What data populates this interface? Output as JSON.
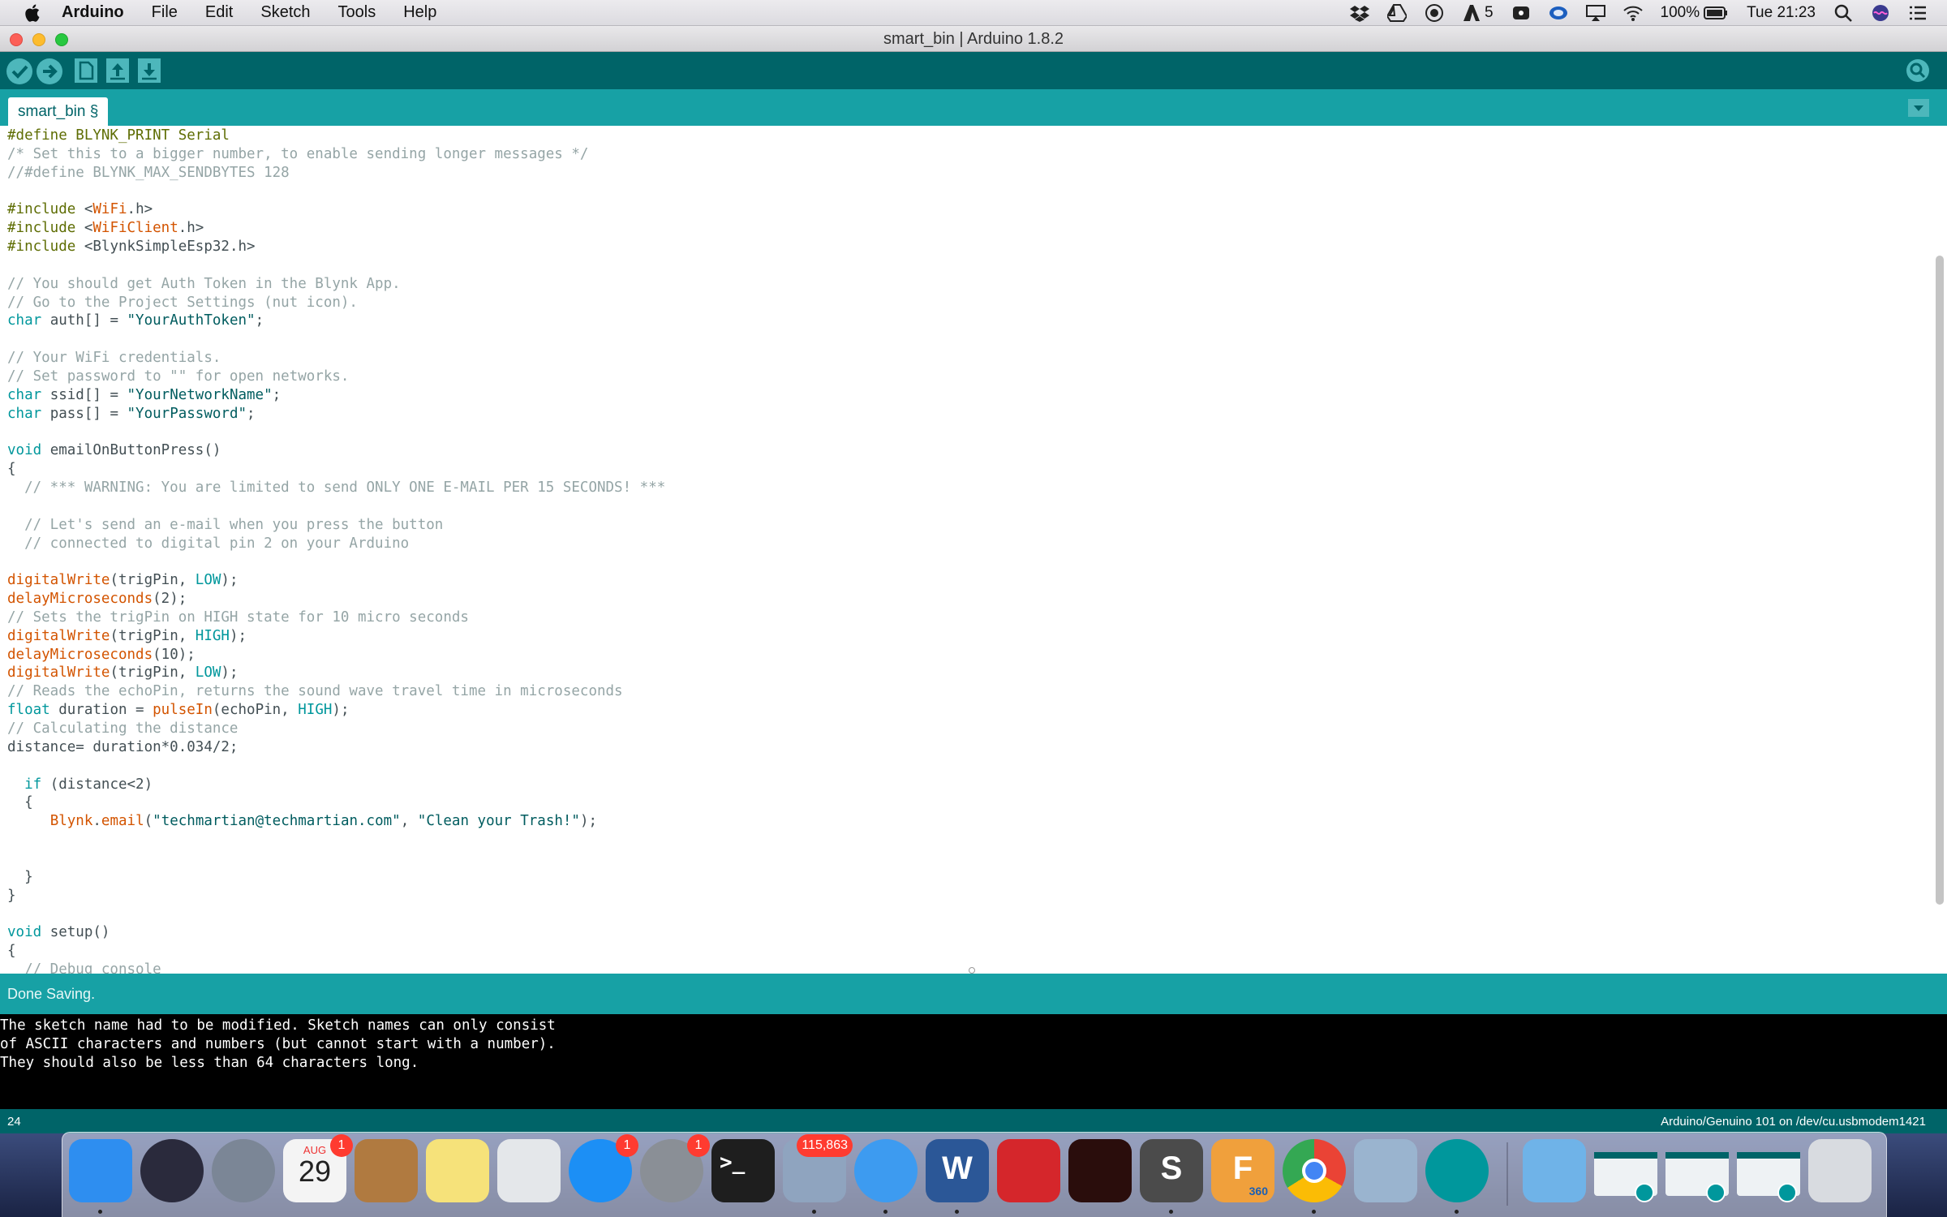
{
  "menubar": {
    "app_name": "Arduino",
    "menus": [
      "File",
      "Edit",
      "Sketch",
      "Tools",
      "Help"
    ],
    "status": {
      "adobe_count": "5",
      "battery": "100%",
      "clock": "Tue 21:23"
    }
  },
  "window": {
    "title": "smart_bin | Arduino 1.8.2"
  },
  "toolbar": {
    "buttons": [
      "verify-icon",
      "upload-icon",
      "new-icon",
      "open-icon",
      "save-icon"
    ],
    "serial_monitor_icon": "magnifier-icon"
  },
  "tabs": {
    "active": "smart_bin §"
  },
  "code_lines": [
    "#define BLYNK_PRINT Serial",
    "/* Set this to a bigger number, to enable sending longer messages */",
    "//#define BLYNK_MAX_SENDBYTES 128",
    "",
    "#include <WiFi.h>",
    "#include <WiFiClient.h>",
    "#include <BlynkSimpleEsp32.h>",
    "",
    "// You should get Auth Token in the Blynk App.",
    "// Go to the Project Settings (nut icon).",
    "char auth[] = \"YourAuthToken\";",
    "",
    "// Your WiFi credentials.",
    "// Set password to \"\" for open networks.",
    "char ssid[] = \"YourNetworkName\";",
    "char pass[] = \"YourPassword\";",
    "",
    "void emailOnButtonPress()",
    "{",
    "  // *** WARNING: You are limited to send ONLY ONE E-MAIL PER 15 SECONDS! ***",
    "",
    "  // Let's send an e-mail when you press the button",
    "  // connected to digital pin 2 on your Arduino",
    "",
    "digitalWrite(trigPin, LOW);",
    "delayMicroseconds(2);",
    "// Sets the trigPin on HIGH state for 10 micro seconds",
    "digitalWrite(trigPin, HIGH);",
    "delayMicroseconds(10);",
    "digitalWrite(trigPin, LOW);",
    "// Reads the echoPin, returns the sound wave travel time in microseconds",
    "float duration = pulseIn(echoPin, HIGH);",
    "// Calculating the distance",
    "distance= duration*0.034/2;",
    "",
    "  if (distance<2)",
    "  {",
    "     Blynk.email(\"techmartian@techmartian.com\", \"Clean your Trash!\");",
    "",
    "",
    "  }",
    "}",
    "",
    "void setup()",
    "{",
    "  // Debug console"
  ],
  "status": {
    "message": "Done Saving."
  },
  "console_lines": [
    "The sketch name had to be modified. Sketch names can only consist",
    "of ASCII characters and numbers (but cannot start with a number).",
    "They should also be less than 64 characters long."
  ],
  "footer": {
    "line_number": "24",
    "board": "Arduino/Genuino 101 on /dev/cu.usbmodem1421"
  },
  "dock": {
    "apps": [
      {
        "name": "finder-icon"
      },
      {
        "name": "siri-icon"
      },
      {
        "name": "launchpad-icon"
      },
      {
        "name": "calendar-icon",
        "month": "AUG",
        "day": "29",
        "badge": "1"
      },
      {
        "name": "contacts-icon"
      },
      {
        "name": "notes-icon"
      },
      {
        "name": "preview-icon"
      },
      {
        "name": "app-store-icon",
        "badge": "1"
      },
      {
        "name": "system-preferences-icon",
        "badge": "1"
      },
      {
        "name": "terminal-icon",
        "glyph": ">_"
      },
      {
        "name": "mail-icon",
        "badge": "115,863"
      },
      {
        "name": "safari-icon"
      },
      {
        "name": "word-icon",
        "glyph": "W"
      },
      {
        "name": "autocad-icon"
      },
      {
        "name": "acrobat-icon"
      },
      {
        "name": "sublime-text-icon",
        "glyph": "S"
      },
      {
        "name": "fusion360-icon",
        "glyph": "F",
        "sub": "360"
      },
      {
        "name": "chrome-icon"
      },
      {
        "name": "image-viewer-icon"
      },
      {
        "name": "arduino-icon"
      }
    ],
    "right": [
      "downloads-folder-icon",
      "arduino-window-thumbnail",
      "arduino-window-thumbnail",
      "arduino-window-thumbnail",
      "trash-icon"
    ],
    "colors": {
      "finder": "#2e8ef0",
      "siri": "#2a2a3c",
      "launchpad": "#7b8696",
      "calendar": "#f4f4f4",
      "contacts": "#b07a40",
      "notes": "#f6e27a",
      "preview": "#e4e7ea",
      "app_store": "#1c8ff5",
      "system_prefs": "#8a8f96",
      "terminal": "#1e1e1e",
      "mail": "#8fa4bf",
      "safari": "#3d9bf0",
      "word": "#2b5797",
      "autocad": "#d5262b",
      "acrobat": "#2a0d0c",
      "sublime": "#4b4b4b",
      "fusion": "#f0a03c",
      "chrome": "#ffffff",
      "viewer": "#9ab4cf",
      "arduino": "#00979c"
    }
  }
}
